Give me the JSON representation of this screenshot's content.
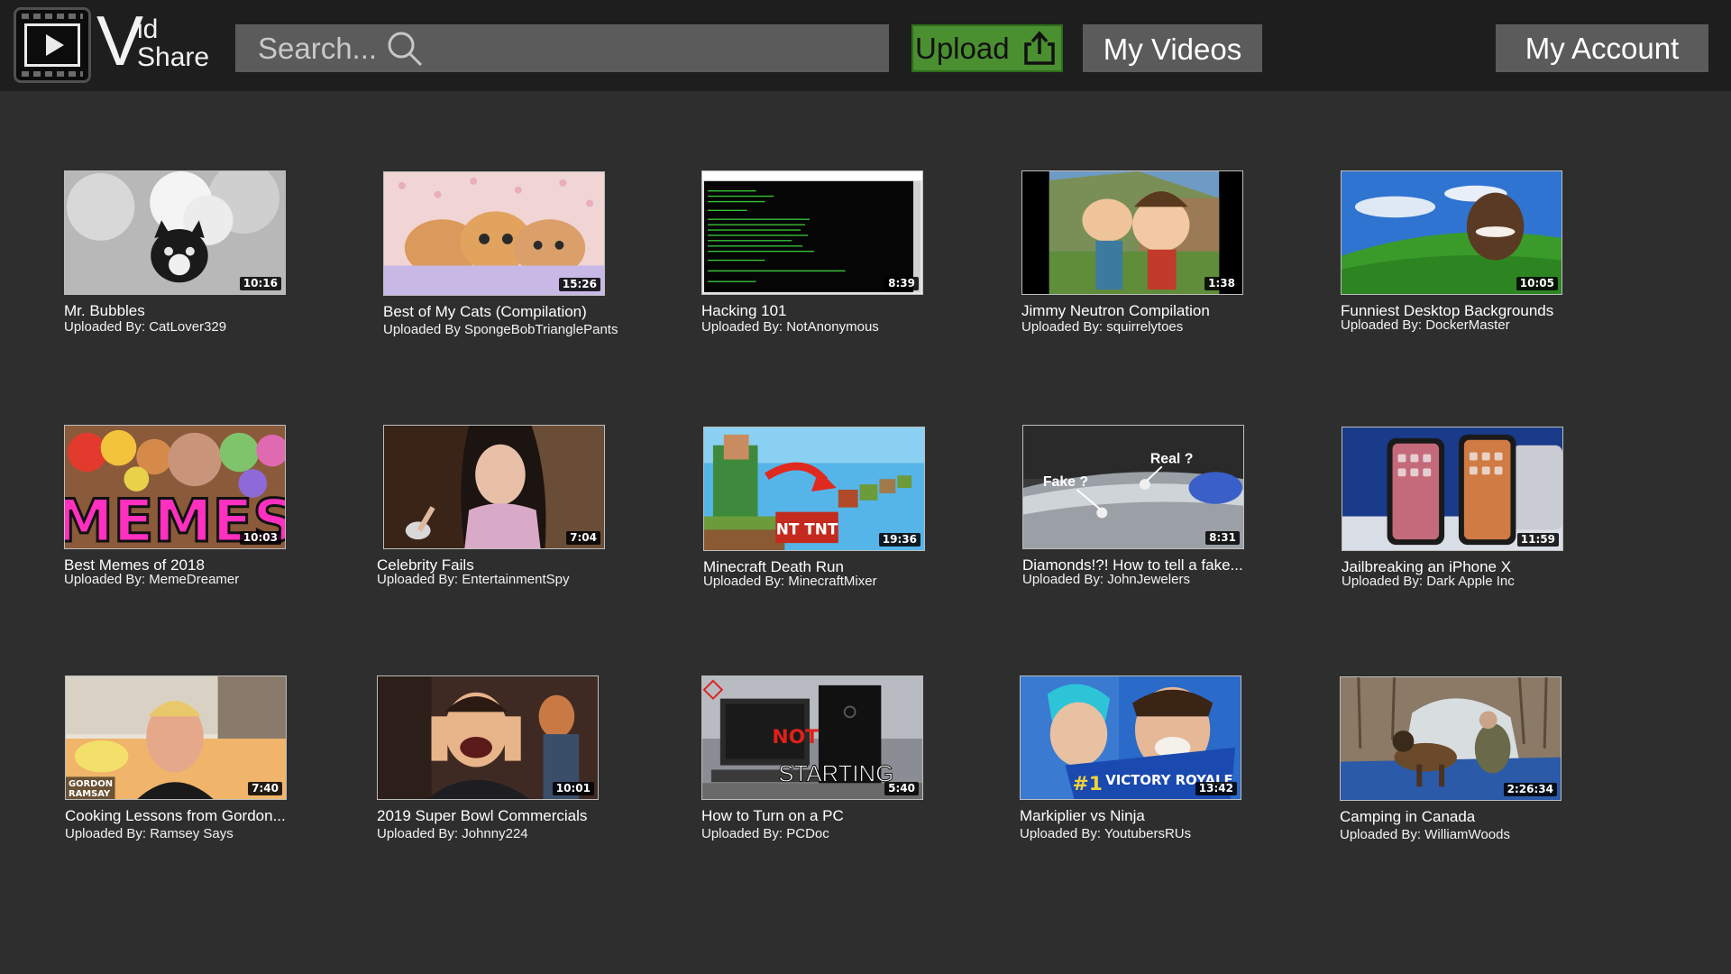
{
  "app": {
    "logo_v": "V",
    "logo_id": "id",
    "logo_share": "Share"
  },
  "search": {
    "placeholder": "Search..."
  },
  "nav": {
    "upload": "Upload",
    "my_videos": "My Videos",
    "my_account": "My Account"
  },
  "colors": {
    "upload_green": "#4a8f30",
    "button_gray": "#5b5b5b",
    "header_bg": "#1e1e1e",
    "page_bg": "#2e2e2e"
  },
  "videos": [
    {
      "title": "Mr. Bubbles",
      "uploader": "Uploaded By: CatLover329",
      "duration": "10:16",
      "thumb": "cat-in-bubbles"
    },
    {
      "title": "Best of My Cats (Compilation)",
      "uploader": "Uploaded By SpongeBobTrianglePants",
      "duration": "15:26",
      "thumb": "three-kittens"
    },
    {
      "title": "Hacking 101",
      "uploader": "Uploaded By: NotAnonymous",
      "duration": "8:39",
      "thumb": "terminal-window"
    },
    {
      "title": "Jimmy Neutron Compilation",
      "uploader": "Uploaded By: squirrelytoes",
      "duration": "1:38",
      "thumb": "cartoon-characters"
    },
    {
      "title": "Funniest Desktop Backgrounds",
      "uploader": "Uploaded By: DockerMaster",
      "duration": "10:05",
      "thumb": "green-hill-face"
    },
    {
      "title": "Best Memes of 2018",
      "uploader": "Uploaded By: MemeDreamer",
      "duration": "10:03",
      "thumb": "memes-collage",
      "overlay": "MEMES"
    },
    {
      "title": "Celebrity Fails",
      "uploader": "Uploaded By: EntertainmentSpy",
      "duration": "7:04",
      "thumb": "singer-on-stage"
    },
    {
      "title": "Minecraft Death Run",
      "uploader": "Uploaded By: MinecraftMixer",
      "duration": "19:36",
      "thumb": "minecraft-blocks",
      "overlay": "NT TNT"
    },
    {
      "title": "Diamonds!?! How to tell a fake...",
      "uploader": "Uploaded By: JohnJewelers",
      "duration": "8:31",
      "thumb": "diamond-test",
      "overlay_a": "Fake ?",
      "overlay_b": "Real ?"
    },
    {
      "title": "Jailbreaking an iPhone X",
      "uploader": "Uploaded By: Dark Apple Inc",
      "duration": "11:59",
      "thumb": "iphones"
    },
    {
      "title": "Cooking Lessons from Gordon...",
      "uploader": "Uploaded By: Ramsey Says",
      "duration": "7:40",
      "thumb": "chef-portrait",
      "overlay_a": "GORDON",
      "overlay_b": "RAMSAY"
    },
    {
      "title": "2019 Super Bowl Commercials",
      "uploader": "Uploaded By: Johnny224",
      "duration": "10:01",
      "thumb": "excited-man"
    },
    {
      "title": "How to Turn on a PC",
      "uploader": "Uploaded By: PCDoc",
      "duration": "5:40",
      "thumb": "desktop-pc",
      "overlay_a": "NOT",
      "overlay_b": "STARTING"
    },
    {
      "title": "Markiplier vs Ninja",
      "uploader": "Uploaded By: YoutubersRUs",
      "duration": "13:42",
      "thumb": "gamer-faces",
      "overlay_a": "#1",
      "overlay_b": "VICTORY ROYALE"
    },
    {
      "title": "Camping in Canada",
      "uploader": "Uploaded By: WilliamWoods",
      "duration": "2:26:34",
      "thumb": "dog-camping"
    }
  ]
}
